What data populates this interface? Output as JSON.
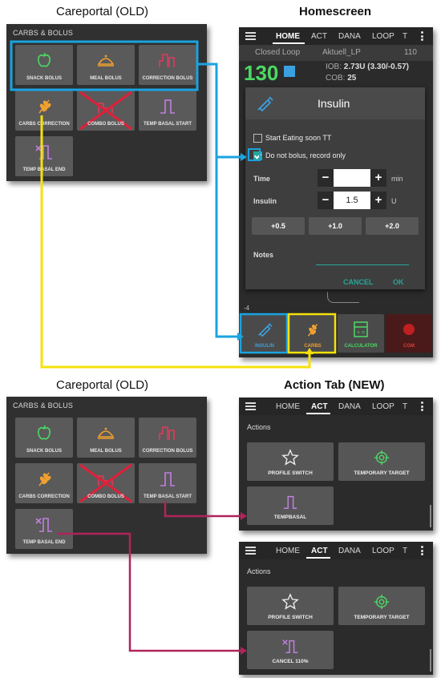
{
  "captions": {
    "top_left": "Careportal (OLD)",
    "top_right": "Homescreen",
    "bottom_left": "Careportal (OLD)",
    "bottom_right": "Action Tab (NEW)"
  },
  "careportal": {
    "title": "CARBS & BOLUS",
    "buttons": [
      {
        "label": "SNACK BOLUS",
        "icon": "apple-icon",
        "color": "#4cd964"
      },
      {
        "label": "MEAL BOLUS",
        "icon": "meal-cloche-icon",
        "color": "#f0a030"
      },
      {
        "label": "CORRECTION BOLUS",
        "icon": "correction-bolus-icon",
        "color": "#e03a5a"
      },
      {
        "label": "CARBS CORRECTION",
        "icon": "wheat-icon",
        "color": "#f0a030"
      },
      {
        "label": "COMBO BOLUS",
        "icon": "combo-bolus-icon",
        "color": "#e03a5a"
      },
      {
        "label": "TEMP BASAL START",
        "icon": "temp-basal-start-icon",
        "color": "#c080e0"
      },
      {
        "label": "TEMP BASAL END",
        "icon": "temp-basal-end-icon",
        "color": "#c080e0"
      }
    ]
  },
  "homescreen": {
    "tabs": [
      "HOME",
      "ACT",
      "DANA",
      "LOOP",
      "T"
    ],
    "active_tab": "HOME",
    "status": {
      "mode": "Closed Loop",
      "profile": "Aktuell_LP",
      "target": "110"
    },
    "bg_value": "130",
    "iob_label": "IOB:",
    "iob_value": "2.73U (3.30/-0.57)",
    "cob_label": "COB:",
    "cob_value": "25",
    "graph_axis_visible": "-4",
    "dialog": {
      "title": "Insulin",
      "eating_soon_label": "Start Eating soon TT",
      "eating_soon_checked": false,
      "record_only_label": "Do not bolus, record only",
      "record_only_checked": true,
      "time_label": "Time",
      "time_value": "",
      "time_unit": "min",
      "insulin_label": "Insulin",
      "insulin_value": "1.5",
      "insulin_unit": "U",
      "increments": [
        "+0.5",
        "+1.0",
        "+2.0"
      ],
      "notes_label": "Notes",
      "cancel_label": "CANCEL",
      "ok_label": "OK"
    },
    "bottom_buttons": [
      {
        "label": "INSULIN",
        "color": "#3aa0e0"
      },
      {
        "label": "CARBS",
        "color": "#f0a030"
      },
      {
        "label": "CALCULATOR",
        "color": "#4cd964"
      },
      {
        "label": "CGM",
        "color": "#e03a3a"
      }
    ]
  },
  "action_tab_1": {
    "tabs": [
      "HOME",
      "ACT",
      "DANA",
      "LOOP",
      "T"
    ],
    "active_tab": "ACT",
    "section_label": "Actions",
    "buttons": [
      {
        "label": "PROFILE SWITCH",
        "icon": "star-icon"
      },
      {
        "label": "TEMPORARY TARGET",
        "icon": "target-icon"
      },
      {
        "label": "TEMPBASAL",
        "icon": "temp-basal-start-icon"
      }
    ]
  },
  "action_tab_2": {
    "tabs": [
      "HOME",
      "ACT",
      "DANA",
      "LOOP",
      "T"
    ],
    "active_tab": "ACT",
    "section_label": "Actions",
    "buttons": [
      {
        "label": "PROFILE SWITCH",
        "icon": "star-icon"
      },
      {
        "label": "TEMPORARY TARGET",
        "icon": "target-icon"
      },
      {
        "label": "CANCEL 110%",
        "icon": "temp-basal-end-icon"
      }
    ]
  },
  "colors": {
    "highlight_blue": "#1aa3e0",
    "highlight_yellow": "#f5e10a",
    "highlight_magenta": "#b0245a",
    "accent_teal": "#26a69a"
  }
}
